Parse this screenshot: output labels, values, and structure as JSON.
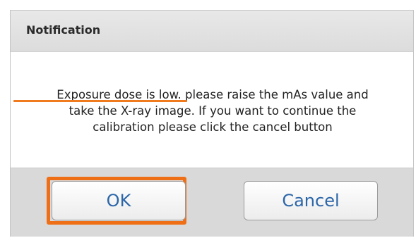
{
  "dialog": {
    "title": "Notification",
    "message": "Exposure dose is low. please raise the mAs value and\ntake the X-ray image. If you want to continue the\ncalibration please click the cancel button"
  },
  "buttons": {
    "ok_label": "OK",
    "cancel_label": "Cancel"
  },
  "colors": {
    "annotation": "#ef6f16",
    "button_text": "#2c66a8",
    "header_bg": "#e2e2e2",
    "footer_bg": "#d9d9d9"
  }
}
